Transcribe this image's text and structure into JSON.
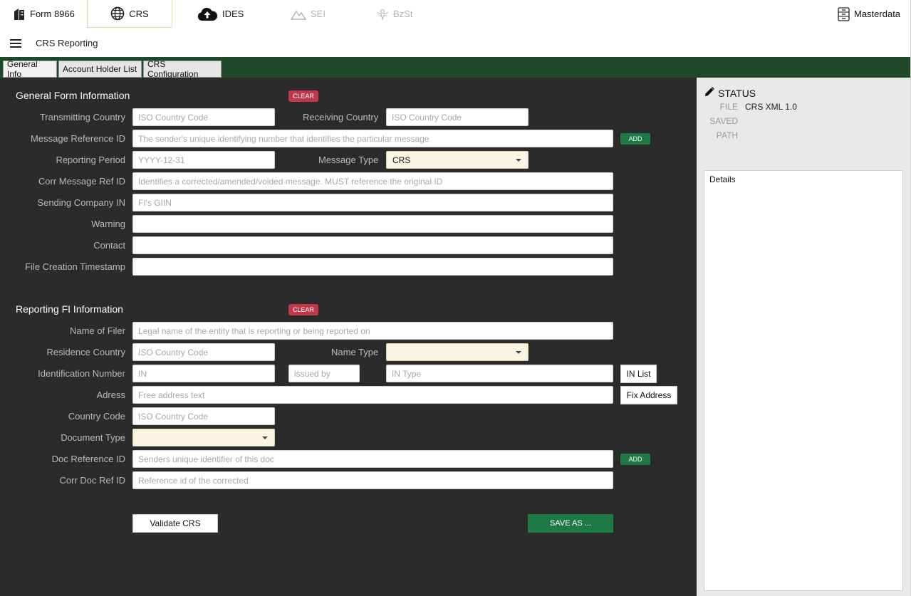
{
  "nav": {
    "tabs": [
      {
        "label": "Form 8966",
        "icon": "building-icon"
      },
      {
        "label": "CRS",
        "icon": "globe-icon"
      },
      {
        "label": "IDES",
        "icon": "cloud-upload-icon"
      },
      {
        "label": "SEI",
        "icon": "mountain-icon"
      },
      {
        "label": "BzSt",
        "icon": "eagle-icon"
      }
    ],
    "masterdata": {
      "label": "Masterdata",
      "icon": "filing-cabinet-icon"
    }
  },
  "subbar": {
    "title": "CRS Reporting"
  },
  "sheet_tabs": [
    "General Info",
    "Account Holder List",
    "CRS Configuration"
  ],
  "general": {
    "title": "General Form Information",
    "clear": "CLEAR",
    "transmitting_country": {
      "label": "Transmitting Country",
      "placeholder": "ISO Country Code"
    },
    "receiving_country": {
      "label": "Receiving Country",
      "placeholder": "ISO Country Code"
    },
    "message_ref": {
      "label": "Message Reference ID",
      "placeholder": "The sender's unique identifying number that identifies the particular message",
      "add": "ADD"
    },
    "reporting_period": {
      "label": "Reporting Period",
      "placeholder": "YYYY-12-31"
    },
    "message_type": {
      "label": "Message Type",
      "value": "CRS"
    },
    "corr_message": {
      "label": "Corr Message Ref ID",
      "placeholder": "Identifies a corrected/amended/voided message. MUST reference the original ID"
    },
    "sending_company": {
      "label": "Sending Company IN",
      "placeholder": "FI's GIIN"
    },
    "warning": {
      "label": "Warning",
      "placeholder": ""
    },
    "contact": {
      "label": "Contact",
      "placeholder": ""
    },
    "timestamp": {
      "label": "File Creation Timestamp",
      "placeholder": ""
    }
  },
  "fi": {
    "title": "Reporting FI Information",
    "clear": "CLEAR",
    "name": {
      "label": "Name of Filer",
      "placeholder": "Legal name of the entity that is reporting or being reported on"
    },
    "residence": {
      "label": "Residence Country",
      "placeholder": "ISO Country Code"
    },
    "name_type": {
      "label": "Name Type",
      "value": ""
    },
    "id_number": {
      "label": "Identification Number",
      "placeholder": "IN",
      "issued_by": "issued by",
      "in_type": "IN Type",
      "in_list": "IN List"
    },
    "address": {
      "label": "Adress",
      "placeholder": "Free address text",
      "fix": "Fix Address"
    },
    "country_code": {
      "label": "Country Code",
      "placeholder": "ISO Country Code"
    },
    "doc_type": {
      "label": "Document Type",
      "value": ""
    },
    "doc_ref": {
      "label": "Doc Reference ID",
      "placeholder": "Senders unique identifier of this doc",
      "add": "ADD"
    },
    "corr_doc": {
      "label": "Corr Doc Ref ID",
      "placeholder": "Reference id of the corrected"
    }
  },
  "actions": {
    "validate": "Validate CRS",
    "save_as": "SAVE AS ..."
  },
  "status": {
    "title": "STATUS",
    "file_key": "FILE",
    "file_val": "CRS XML 1.0",
    "saved_key": "SAVED",
    "saved_val": "",
    "path_key": "PATH",
    "path_val": "",
    "details": "Details"
  },
  "colors": {
    "header_green": "#1f4a2a",
    "panel_dark": "#2b2b2b",
    "clear_red": "#c0384a",
    "add_green": "#1e7a44",
    "select_cream": "#fbf5e3"
  }
}
